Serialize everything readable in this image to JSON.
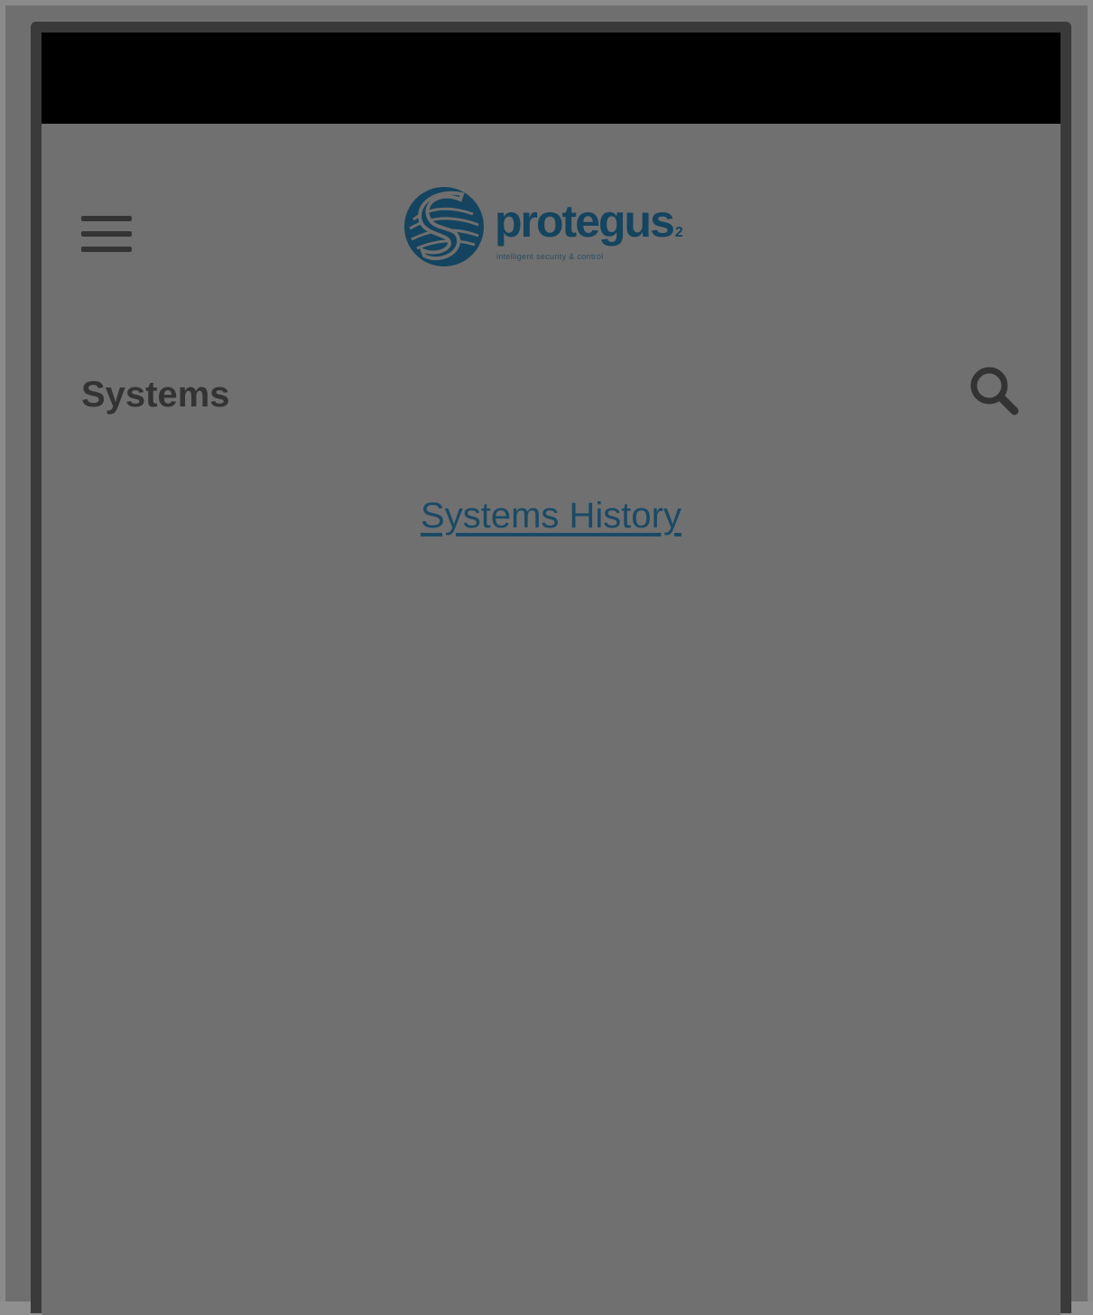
{
  "colors": {
    "overlay_background": "#707070",
    "status_bar": "#000000",
    "brand": "#14445f",
    "link": "#1a4a66",
    "title_text": "#333333"
  },
  "header": {
    "menu_icon": "hamburger-menu-icon",
    "logo": {
      "word": "protegus",
      "superscript": "2",
      "tagline": "intelligent security & control"
    }
  },
  "main": {
    "title": "Systems",
    "search_icon": "search-icon",
    "history_link": "Systems History"
  }
}
